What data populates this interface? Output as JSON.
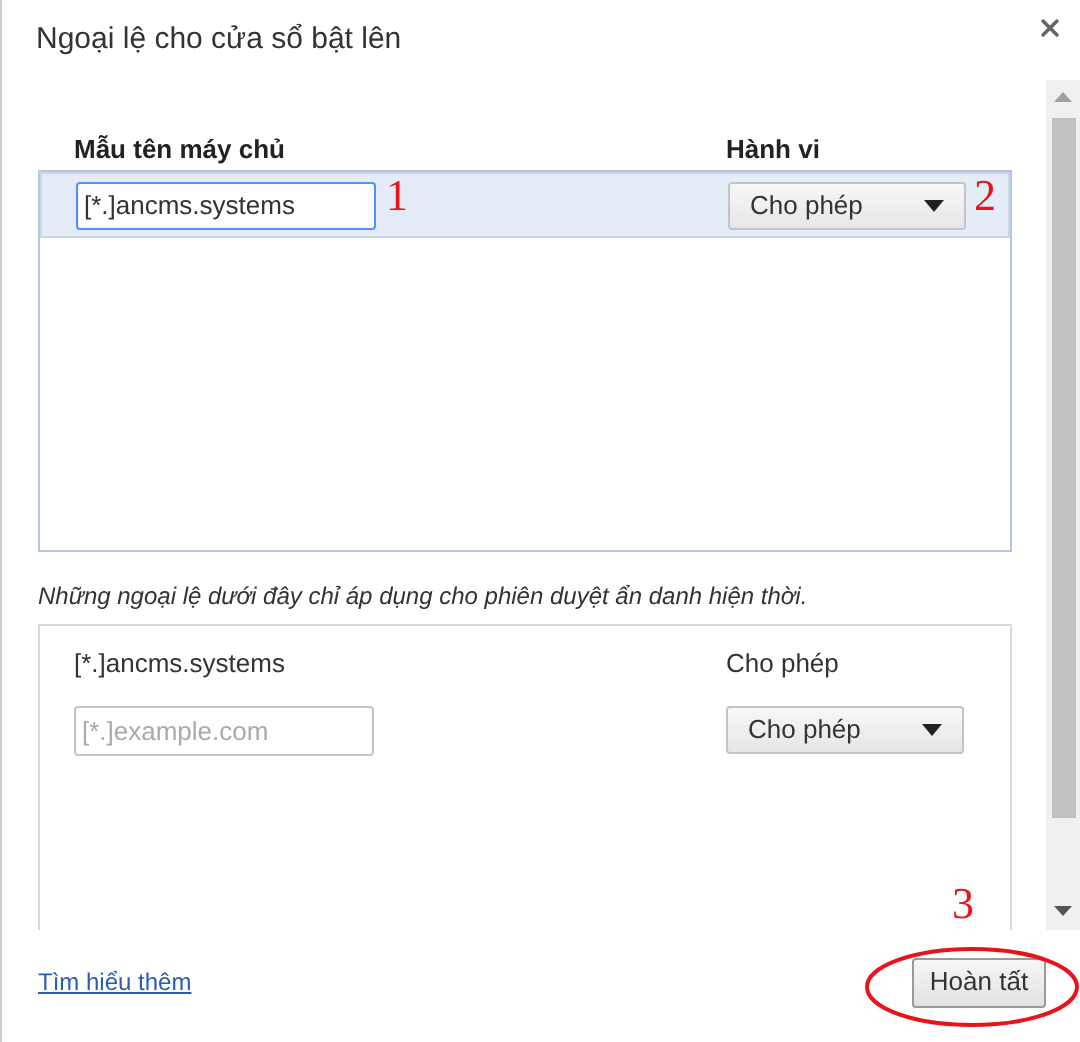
{
  "dialog": {
    "title": "Ngoại lệ cho cửa sổ bật lên"
  },
  "columns": [
    "Mẫu tên máy chủ",
    "Hành vi"
  ],
  "exceptions": [
    {
      "pattern": "[*.]ancms.systems",
      "behavior": "Cho phép",
      "selected": true,
      "editing": true
    }
  ],
  "incognito_note": "Những ngoại lệ dưới đây chỉ áp dụng cho phiên duyệt ẩn danh hiện thời.",
  "incognito_exceptions": [
    {
      "pattern": "[*.]ancms.systems",
      "behavior": "Cho phép",
      "selected": false,
      "editing": false
    }
  ],
  "new_entry": {
    "placeholder": "[*.]example.com",
    "behavior": "Cho phép"
  },
  "learn_more": "Tìm hiểu thêm",
  "done_button": "Hoàn tất",
  "annotations": [
    {
      "kind": "number",
      "text": "1"
    },
    {
      "kind": "number",
      "text": "2"
    },
    {
      "kind": "number",
      "text": "3"
    },
    {
      "kind": "ellipse"
    }
  ]
}
